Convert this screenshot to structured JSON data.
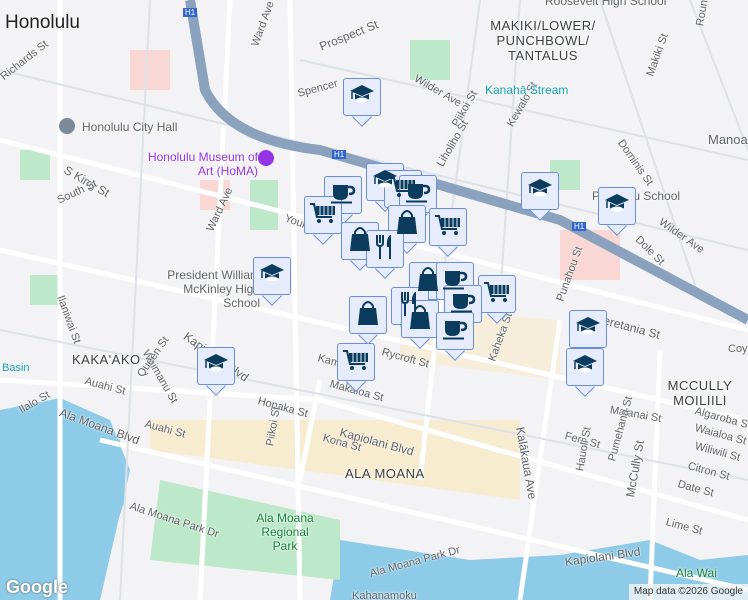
{
  "map": {
    "labels": {
      "honolulu": "Honolulu",
      "richards": "Richards St",
      "city_hall": "Honolulu City Hall",
      "s_king": "S King St",
      "south": "South St",
      "homa": "Honolulu Museum of Art (HoMA)",
      "ward1": "Ward Ave",
      "ward2": "Ward Ave",
      "prospect": "Prospect St",
      "spencer": "Spencer",
      "wilder1": "Wilder Ave",
      "piikoi1": "Piikoi St",
      "kewalo": "Kewalo St",
      "liholiho": "Liholiho St",
      "stream": "Kanahā Stream",
      "makiki_area": "MAKIKI/LOWER/ PUNCHBOWL/ TANTALUS",
      "roosevelt": "Roosevelt High School",
      "makiki": "Makiki St",
      "roundtop": "Round Top Dr",
      "dominis": "Dominis St",
      "manoa": "Manoa",
      "punahou_school": "Punahou School",
      "wilder2": "Wilder Ave",
      "dole": "Dole St",
      "punahou": "Punahou St",
      "beretania": "S Beretania St",
      "coyne": "Coyne",
      "young": "Young St",
      "mckinley": "President William McKinley High School",
      "ilaniwai": "Ilaniwai St",
      "kawaiahao": "Waimanu St",
      "queen": "Queen St",
      "kakaako": "KAKA'AKO",
      "kapiolani1": "Kapiolani Blvd",
      "kapiolani2": "Kapiolani Blvd",
      "kapiolani3": "Kapiolani Blvd",
      "auahi1": "Auahi St",
      "auahi2": "Auahi St",
      "ala_moana_blvd": "Ala Moana Blvd",
      "ilalo": "Ilalo St",
      "hopaka": "Hopaka St",
      "makaloa": "Makaloa St",
      "kona": "Kona St",
      "rycroft": "Rycroft St",
      "kaheka": "Kaheka St",
      "kalakaua": "Kalākaua Ave",
      "ala_moana": "ALA MOANA",
      "piikoi2": "Piikoi St",
      "park_dr1": "Ala Moana Park Dr",
      "park_dr2": "Ala Moana Park Dr",
      "park": "Ala Moana Regional Park",
      "kahanamoku": "Kahanamoku",
      "mccully_area": "MCCULLY MOILIILI",
      "malanai": "Malanai St",
      "algaroba": "Algaroba S",
      "waialoa": "Waialoa St",
      "wiliwili": "Wiliwili St",
      "citron": "Citron St",
      "date": "Date St",
      "fern": "Fern St",
      "hauoli": "Hauoli St",
      "pumehana": "Pumehana St",
      "mccully": "McCully St",
      "lime": "Lime St",
      "ala_wai": "Ala Wai",
      "kam": "Kam",
      "basin": "Basin",
      "h1a": "H1",
      "h1b": "H1",
      "h1c": "H1"
    },
    "markers": [
      "school",
      "school",
      "cart",
      "coffee",
      "coffee",
      "cart",
      "bag",
      "cart",
      "bag",
      "fork",
      "school",
      "school",
      "school",
      "bag",
      "coffee",
      "cart",
      "coffee",
      "fork",
      "bag",
      "bag",
      "coffee",
      "cart",
      "school",
      "school",
      "school"
    ],
    "colors": {
      "marker_fill": "#e6ecfb",
      "marker_border": "#6d8fd8",
      "icon": "#0b3c5d",
      "freeway": "#8aa2bd",
      "water": "#8ecbe8",
      "park": "#bde8c9",
      "sand": "#f7ecd0",
      "museum": "#9334e6"
    }
  },
  "footer": {
    "logo": "Google",
    "attribution": "Map data ©2026 Google"
  }
}
